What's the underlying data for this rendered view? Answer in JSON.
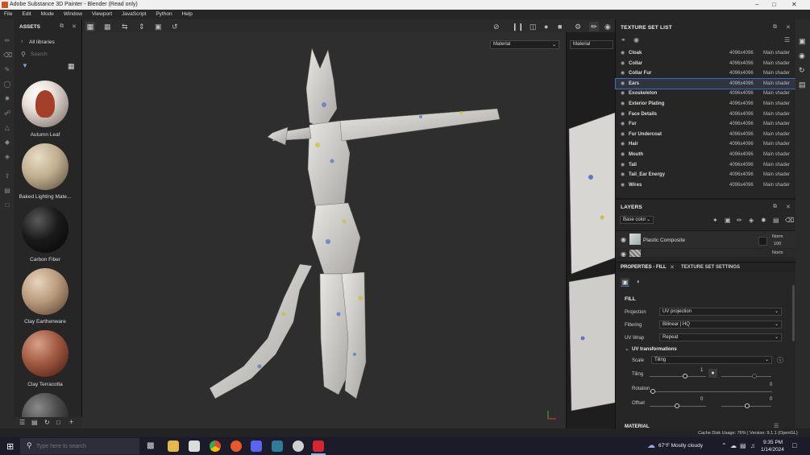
{
  "window": {
    "title": "Adobe Substance 3D Painter - Blender (Read only)",
    "min_icon": "minimize-icon",
    "max_icon": "maximize-icon",
    "close_icon": "close-icon"
  },
  "menu": [
    "File",
    "Edit",
    "Mode",
    "Window",
    "Viewport",
    "JavaScript",
    "Python",
    "Help"
  ],
  "assets": {
    "title": "ASSETS",
    "library": "All libraries",
    "search_placeholder": "Search",
    "items": [
      {
        "label": "Autumn Leaf",
        "color": "#8a3a2a"
      },
      {
        "label": "Baked Lighting Mate...",
        "color": "#b8a888"
      },
      {
        "label": "Carbon Fiber",
        "color": "#111111"
      },
      {
        "label": "Clay Earthenware",
        "color": "#b39980"
      },
      {
        "label": "Clay Terracotta",
        "color": "#8a4a38"
      }
    ]
  },
  "viewport": {
    "material_left": "Material",
    "material_right": "Material"
  },
  "texture_sets": {
    "title": "TEXTURE SET LIST",
    "rows": [
      {
        "name": "Cloak",
        "res": "4096x4096",
        "shader": "Main shader"
      },
      {
        "name": "Collar",
        "res": "4096x4096",
        "shader": "Main shader"
      },
      {
        "name": "Collar Fur",
        "res": "4096x4096",
        "shader": "Main shader"
      },
      {
        "name": "Ears",
        "res": "4096x4096",
        "shader": "Main shader"
      },
      {
        "name": "Exoskeleton",
        "res": "4096x4096",
        "shader": "Main shader"
      },
      {
        "name": "Exterior Plating",
        "res": "4096x4096",
        "shader": "Main shader"
      },
      {
        "name": "Face Details",
        "res": "4096x4096",
        "shader": "Main shader"
      },
      {
        "name": "Fur",
        "res": "4096x4096",
        "shader": "Main shader"
      },
      {
        "name": "Fur Undercoat",
        "res": "4096x4096",
        "shader": "Main shader"
      },
      {
        "name": "Hair",
        "res": "4096x4096",
        "shader": "Main shader"
      },
      {
        "name": "Mouth",
        "res": "4096x4096",
        "shader": "Main shader"
      },
      {
        "name": "Tail",
        "res": "4096x4096",
        "shader": "Main shader"
      },
      {
        "name": "Tail_Ear Energy",
        "res": "4096x4096",
        "shader": "Main shader"
      },
      {
        "name": "Wires",
        "res": "4096x4096",
        "shader": "Main shader"
      }
    ],
    "active": "Ears"
  },
  "layers": {
    "title": "LAYERS",
    "channel": "Base color",
    "layer_name": "Plastic Composite",
    "blend": "Norm",
    "opacity": "100",
    "blend2": "Norm"
  },
  "properties": {
    "tab_fill": "PROPERTIES - FILL",
    "tab_tss": "TEXTURE SET SETTINGS",
    "fill_title": "FILL",
    "projection_label": "Projection",
    "projection_value": "UV projection",
    "filtering_label": "Filtering",
    "filtering_value": "Bilinear | HQ",
    "uvwrap_label": "UV Wrap",
    "uvwrap_value": "Repeat",
    "uvtrans_title": "UV transformations",
    "scale_label": "Scale",
    "scale_value": "Tiling",
    "tiling_label": "Tiling",
    "tiling_value": "1",
    "rotation_label": "Rotation",
    "rotation_value": "0",
    "offset_label": "Offset",
    "offset_x": "0",
    "offset_y": "0",
    "material_title": "MATERIAL"
  },
  "status": {
    "text": "Cache Disk Usage: 76% | Version: 9.1.1 (OpenGL)"
  },
  "taskbar": {
    "search_placeholder": "Type here to search",
    "weather": "67°F  Mostly cloudy",
    "time": "9:35 PM",
    "date": "1/14/2024"
  }
}
